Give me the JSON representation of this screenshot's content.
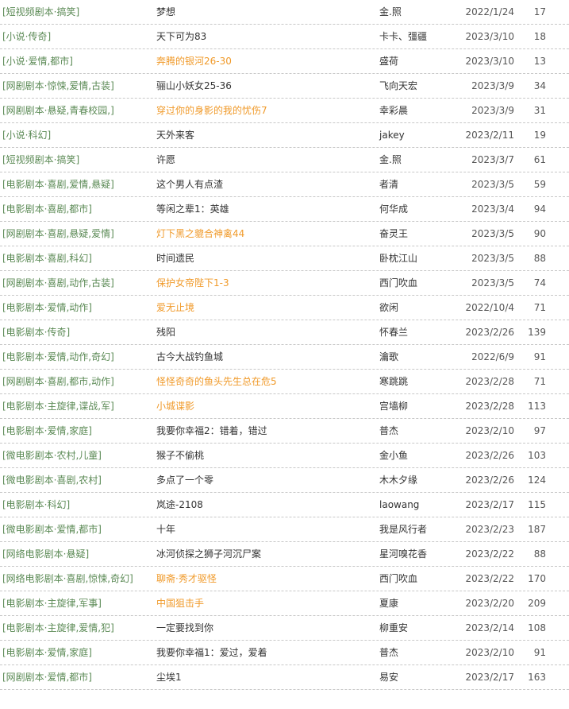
{
  "colors": {
    "category": "#5b8a55",
    "highlight_title": "#f09a2a",
    "text": "#333333",
    "divider": "#c8c8c8"
  },
  "rows": [
    {
      "category": "[短视频剧本·搞笑]",
      "title": "梦想",
      "highlight": false,
      "author": "金.照",
      "date": "2022/1/24",
      "count": "17"
    },
    {
      "category": "[小说·传奇]",
      "title": "天下可为83",
      "highlight": false,
      "author": "卡卡、彊疆",
      "date": "2023/3/10",
      "count": "18"
    },
    {
      "category": "[小说·爱情,都市]",
      "title": "奔腾的银河26-30",
      "highlight": true,
      "author": "盛荷",
      "date": "2023/3/10",
      "count": "13"
    },
    {
      "category": "[网剧剧本·惊悚,爱情,古装]",
      "title": "骊山小妖女25-36",
      "highlight": false,
      "author": "飞向天宏",
      "date": "2023/3/9",
      "count": "34"
    },
    {
      "category": "[网剧剧本·悬疑,青春校园,]",
      "title": "穿过你的身影的我的忧伤7",
      "highlight": true,
      "author": "幸彩晨",
      "date": "2023/3/9",
      "count": "31"
    },
    {
      "category": "[小说·科幻]",
      "title": "天外来客",
      "highlight": false,
      "author": "jakey",
      "date": "2023/2/11",
      "count": "19"
    },
    {
      "category": "[短视频剧本·搞笑]",
      "title": "许愿",
      "highlight": false,
      "author": "金.照",
      "date": "2023/3/7",
      "count": "61"
    },
    {
      "category": "[电影剧本·喜剧,爱情,悬疑]",
      "title": "这个男人有点渣",
      "highlight": false,
      "author": "者清",
      "date": "2023/3/5",
      "count": "59"
    },
    {
      "category": "[电影剧本·喜剧,都市]",
      "title": "等闲之辈1：英雄",
      "highlight": false,
      "author": "何华成",
      "date": "2023/3/4",
      "count": "94"
    },
    {
      "category": "[网剧剧本·喜剧,悬疑,爱情]",
      "title": "灯下黑之貔合神禽44",
      "highlight": true,
      "author": "奋灵王",
      "date": "2023/3/5",
      "count": "90"
    },
    {
      "category": "[电影剧本·喜剧,科幻]",
      "title": "时间遗民",
      "highlight": false,
      "author": "卧枕江山",
      "date": "2023/3/5",
      "count": "88"
    },
    {
      "category": "[网剧剧本·喜剧,动作,古装]",
      "title": "保护女帝陛下1-3",
      "highlight": true,
      "author": "西门吹血",
      "date": "2023/3/5",
      "count": "74"
    },
    {
      "category": "[电影剧本·爱情,动作]",
      "title": "爱无止境",
      "highlight": true,
      "author": "欲闲",
      "date": "2022/10/4",
      "count": "71"
    },
    {
      "category": "[电影剧本·传奇]",
      "title": "残阳",
      "highlight": false,
      "author": "怀春兰",
      "date": "2023/2/26",
      "count": "139"
    },
    {
      "category": "[电影剧本·爱情,动作,奇幻]",
      "title": "古今大战钓鱼城",
      "highlight": false,
      "author": "瀹歌",
      "date": "2022/6/9",
      "count": "91"
    },
    {
      "category": "[网剧剧本·喜剧,都市,动作]",
      "title": "怪怪奇奇的鱼头先生总在危5",
      "highlight": true,
      "author": "寒跳跳",
      "date": "2023/2/28",
      "count": "71"
    },
    {
      "category": "[电影剧本·主旋律,谍战,军]",
      "title": "小城谍影",
      "highlight": true,
      "author": "宫墙柳",
      "date": "2023/2/28",
      "count": "113"
    },
    {
      "category": "[电影剧本·爱情,家庭]",
      "title": "我要你幸福2：错着，错过",
      "highlight": false,
      "author": "普杰",
      "date": "2023/2/10",
      "count": "97"
    },
    {
      "category": "[微电影剧本·农村,儿童]",
      "title": "猴子不偷桃",
      "highlight": false,
      "author": "金小鱼",
      "date": "2023/2/26",
      "count": "103"
    },
    {
      "category": "[微电影剧本·喜剧,农村]",
      "title": "多点了一个零",
      "highlight": false,
      "author": "木木夕缘",
      "date": "2023/2/26",
      "count": "124"
    },
    {
      "category": "[电影剧本·科幻]",
      "title": "岚途-2108",
      "highlight": false,
      "author": "laowang",
      "date": "2023/2/17",
      "count": "115"
    },
    {
      "category": "[微电影剧本·爱情,都市]",
      "title": "十年",
      "highlight": false,
      "author": "我是风行者",
      "date": "2023/2/23",
      "count": "187"
    },
    {
      "category": "[网络电影剧本·悬疑]",
      "title": "冰河侦探之狮子河沉尸案",
      "highlight": false,
      "author": "星河嗅花香",
      "date": "2023/2/22",
      "count": "88"
    },
    {
      "category": "[网络电影剧本·喜剧,惊悚,奇幻]",
      "title": "聊斋·秀才驱怪",
      "highlight": true,
      "author": "西门吹血",
      "date": "2023/2/22",
      "count": "170"
    },
    {
      "category": "[电影剧本·主旋律,军事]",
      "title": "中国狙击手",
      "highlight": true,
      "author": "夏康",
      "date": "2023/2/20",
      "count": "209"
    },
    {
      "category": "[电影剧本·主旋律,爱情,犯]",
      "title": "一定要找到你",
      "highlight": false,
      "author": "柳重安",
      "date": "2023/2/14",
      "count": "108"
    },
    {
      "category": "[电影剧本·爱情,家庭]",
      "title": "我要你幸福1：爱过，爱着",
      "highlight": false,
      "author": "普杰",
      "date": "2023/2/10",
      "count": "91"
    },
    {
      "category": "[网剧剧本·爱情,都市]",
      "title": "尘埃1",
      "highlight": false,
      "author": "易安",
      "date": "2023/2/17",
      "count": "163"
    }
  ]
}
